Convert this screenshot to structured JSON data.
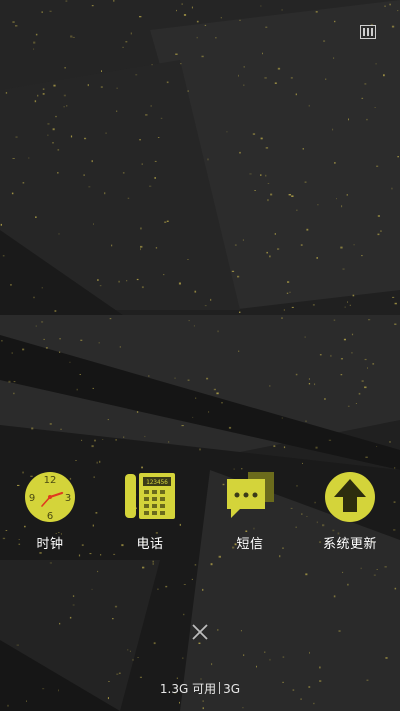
{
  "apps": [
    {
      "label": "时钟",
      "icon": "clock-icon"
    },
    {
      "label": "电话",
      "icon": "phone-icon"
    },
    {
      "label": "短信",
      "icon": "message-icon"
    },
    {
      "label": "系统更新",
      "icon": "update-arrow-icon"
    }
  ],
  "clock_numbers": {
    "n12": "12",
    "n3": "3",
    "n6": "6",
    "n9": "9"
  },
  "phone_display": "123456",
  "memory": {
    "available": "1.3G 可用",
    "total": "3G"
  },
  "colors": {
    "accent": "#d4d43a",
    "icon_dark": "#6b6b1c",
    "background": "#1d1d1d",
    "clock_hand": "#e03a1e"
  }
}
